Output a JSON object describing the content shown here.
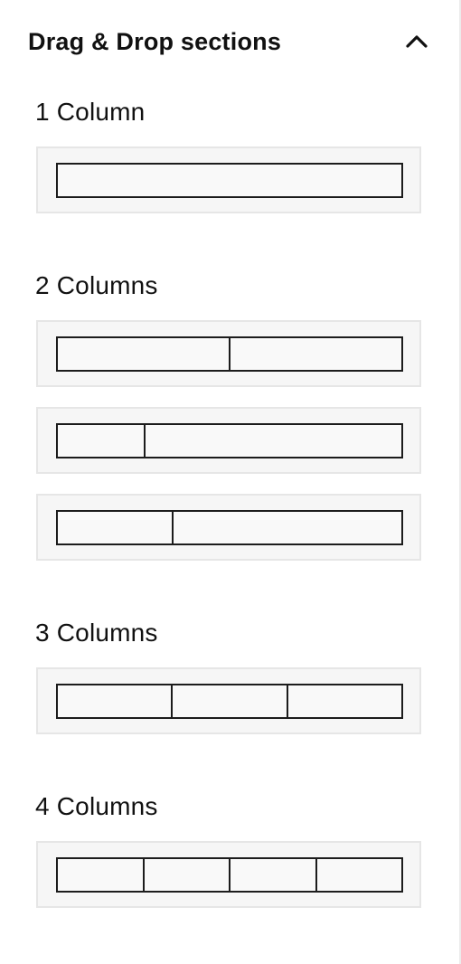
{
  "panel": {
    "title": "Drag & Drop sections",
    "toggle_icon": "chevron-up-icon"
  },
  "groups": [
    {
      "label": "1 Column",
      "layouts": [
        {
          "columns": [
            1
          ]
        }
      ]
    },
    {
      "label": "2 Columns",
      "layouts": [
        {
          "columns": [
            1,
            1
          ]
        },
        {
          "columns": [
            1,
            3
          ]
        },
        {
          "columns": [
            1,
            2
          ]
        }
      ]
    },
    {
      "label": "3 Columns",
      "layouts": [
        {
          "columns": [
            1,
            1,
            1
          ]
        }
      ]
    },
    {
      "label": "4 Columns",
      "layouts": [
        {
          "columns": [
            1,
            1,
            1,
            1
          ]
        }
      ]
    }
  ],
  "colors": {
    "card_background": "#f6f6f6",
    "card_border": "#e6e6e6",
    "bar_border": "#1c1c1c",
    "text": "#111111"
  }
}
